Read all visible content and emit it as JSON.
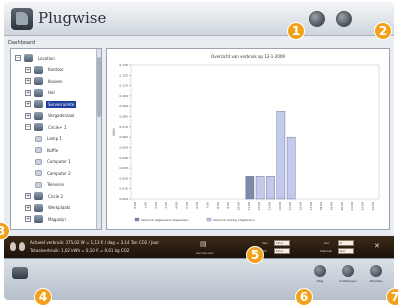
{
  "app": {
    "title": "Plugwise"
  },
  "header": {
    "buttons": [
      "plugs-icon",
      "settings-icon"
    ]
  },
  "dashboard": {
    "label": "Dashboard"
  },
  "tree": {
    "items": [
      {
        "label": "Location",
        "toggle": "−",
        "depth": 0
      },
      {
        "label": "Kantoor",
        "toggle": "+",
        "depth": 1
      },
      {
        "label": "Keuken",
        "toggle": "+",
        "depth": 1
      },
      {
        "label": "Hal",
        "toggle": "+",
        "depth": 1
      },
      {
        "label": "Serverruimte",
        "toggle": "+",
        "depth": 1,
        "selected": true
      },
      {
        "label": "Vergaderzaal",
        "toggle": "+",
        "depth": 1
      },
      {
        "label": "Circle+ 1",
        "toggle": "−",
        "depth": 1
      },
      {
        "label": "Lamp 1",
        "toggle": "",
        "depth": 2
      },
      {
        "label": "Koffie",
        "toggle": "",
        "depth": 2
      },
      {
        "label": "Computer 1",
        "toggle": "",
        "depth": 2
      },
      {
        "label": "Computer 2",
        "toggle": "",
        "depth": 2
      },
      {
        "label": "Televisie",
        "toggle": "",
        "depth": 2
      },
      {
        "label": "Circle 2",
        "toggle": "+",
        "depth": 1
      },
      {
        "label": "Werkplaats",
        "toggle": "+",
        "depth": 1
      },
      {
        "label": "Magazijn",
        "toggle": "+",
        "depth": 1
      }
    ]
  },
  "chart_data": {
    "type": "bar",
    "title": "Overzicht van verbruik op 12-1-2009",
    "ylabel": "kWh",
    "ylim": [
      0,
      0.13
    ],
    "yticks": [
      "0.000",
      "0.010",
      "0.020",
      "0.030",
      "0.040",
      "0.050",
      "0.060",
      "0.070",
      "0.080",
      "0.090",
      "0.100",
      "0.110",
      "0.120",
      "0.130"
    ],
    "categories": [
      "0:00",
      "1:00",
      "2:00",
      "3:00",
      "4:00",
      "5:00",
      "6:00",
      "7:00",
      "8:00",
      "9:00",
      "10:00",
      "11:00",
      "12:00",
      "13:00",
      "14:00",
      "15:00",
      "16:00",
      "17:00",
      "18:00",
      "19:00",
      "20:00",
      "21:00",
      "22:00",
      "23:00"
    ],
    "series": [
      {
        "name": "Verbruik (afgelopen uitgelezen)",
        "color": "#7d8aa8",
        "values": [
          0,
          0,
          0,
          0,
          0,
          0,
          0,
          0,
          0,
          0,
          0,
          0.022,
          0,
          0,
          0,
          0,
          0,
          0,
          0,
          0,
          0,
          0,
          0,
          0
        ]
      },
      {
        "name": "Verbruik (huidig uitgelezen)",
        "color": "#c3c9ec",
        "values": [
          0,
          0,
          0,
          0,
          0,
          0,
          0,
          0,
          0,
          0,
          0,
          0,
          0.022,
          0.022,
          0.085,
          0.06,
          0,
          0,
          0,
          0,
          0,
          0,
          0,
          0
        ]
      }
    ],
    "legend": "bottom-left"
  },
  "status": {
    "line1": "Actueel verbruik: 375,02 W = 1,13 € / dag = 3,14 Ton CO2 / Jaar",
    "line2": "Totaalverbruik: 1,02 kWh = 0,10 € = 0,61 kg CO2",
    "fields": [
      {
        "label": "Van",
        "value": "12-1-2009"
      },
      {
        "label": "t/m",
        "value": "12-1-2009"
      },
      {
        "label": "Uur",
        "value": "0"
      },
      {
        "label": "Interval",
        "value": "Uur"
      }
    ],
    "refresh_label": "Vernieuwen"
  },
  "bottombar": {
    "buttons": [
      {
        "label": "Help",
        "icon": "help-icon"
      },
      {
        "label": "Instellingen",
        "icon": "settings-icon"
      },
      {
        "label": "Afsluiten",
        "icon": "power-icon"
      }
    ]
  },
  "callouts": [
    "1",
    "2",
    "3",
    "4",
    "5",
    "6",
    "7"
  ]
}
